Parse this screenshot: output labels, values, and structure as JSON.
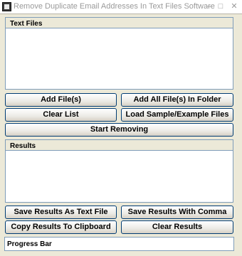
{
  "window": {
    "title": "Remove Duplicate Email Addresses In Text Files Software",
    "minimize_glyph": "–",
    "maximize_glyph": "□",
    "close_glyph": "✕"
  },
  "text_files": {
    "label": "Text Files"
  },
  "buttons": {
    "add_files": "Add File(s)",
    "add_all_files": "Add All File(s) In Folder",
    "clear_list": "Clear List",
    "load_sample": "Load Sample/Example Files",
    "start_removing": "Start Removing",
    "save_text": "Save Results As Text File",
    "save_comma": "Save Results With Comma",
    "copy_clipboard": "Copy Results To Clipboard",
    "clear_results": "Clear Results"
  },
  "results": {
    "label": "Results"
  },
  "progress": {
    "label": "Progress Bar",
    "value": 0
  }
}
